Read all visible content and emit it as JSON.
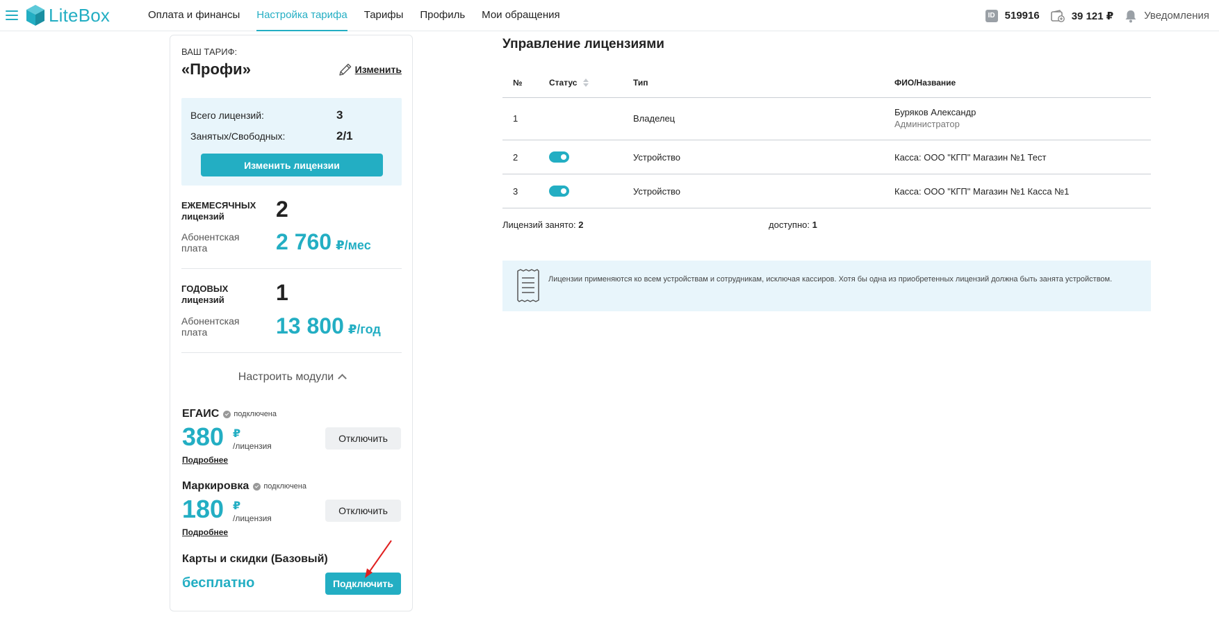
{
  "header": {
    "logo_text": "LiteBox",
    "nav": [
      {
        "label": "Оплата и финансы",
        "active": false
      },
      {
        "label": "Настройка тарифа",
        "active": true
      },
      {
        "label": "Тарифы",
        "active": false
      },
      {
        "label": "Профиль",
        "active": false
      },
      {
        "label": "Мои обращения",
        "active": false
      }
    ],
    "id_badge": "ID",
    "account_id": "519916",
    "balance": "39 121 ₽",
    "notifications_label": "Уведомления"
  },
  "tariff": {
    "label": "ВАШ ТАРИФ:",
    "name": "«Профи»",
    "edit_label": "Изменить",
    "licenses": {
      "total_label": "Всего лицензий:",
      "total_value": "3",
      "used_free_label": "Занятых/Свободных:",
      "used_free_value": "2/1",
      "change_button": "Изменить лицензии"
    },
    "monthly": {
      "title_line1": "ЕЖЕМЕСЯЧНЫХ",
      "title_line2": "лицензий",
      "count": "2",
      "fee_label_line1": "Абонентская",
      "fee_label_line2": "плата",
      "fee_value": "2 760",
      "fee_unit": "₽/мес"
    },
    "yearly": {
      "title_line1": "ГОДОВЫХ",
      "title_line2": "лицензий",
      "count": "1",
      "fee_label_line1": "Абонентская",
      "fee_label_line2": "плата",
      "fee_value": "13 800",
      "fee_unit": "₽/год"
    },
    "modules_toggle": "Настроить модули",
    "modules": [
      {
        "name": "ЕГАИС",
        "status": "подключена",
        "price": "380",
        "currency": "₽",
        "per": "/лицензия",
        "more": "Подробнее",
        "button": "Отключить"
      },
      {
        "name": "Маркировка",
        "status": "подключена",
        "price": "180",
        "currency": "₽",
        "per": "/лицензия",
        "more": "Подробнее",
        "button": "Отключить"
      },
      {
        "name": "Карты и скидки (Базовый)",
        "price_text": "бесплатно",
        "button": "Подключить"
      }
    ]
  },
  "licenses_management": {
    "title": "Управление лицензиями",
    "columns": [
      "№",
      "Статус",
      "Тип",
      "ФИО/Название"
    ],
    "rows": [
      {
        "num": "1",
        "status_on": false,
        "type": "Владелец",
        "name": "Буряков Александр",
        "sub": "Администратор"
      },
      {
        "num": "2",
        "status_on": true,
        "type": "Устройство",
        "name": "Касса: ООО \"КГП\" Магазин №1 Тест",
        "sub": ""
      },
      {
        "num": "3",
        "status_on": true,
        "type": "Устройство",
        "name": "Касса: ООО \"КГП\" Магазин №1 Касса №1",
        "sub": ""
      }
    ],
    "summary_used_label": "Лицензий занято:",
    "summary_used_value": "2",
    "summary_available_label": "доступно:",
    "summary_available_value": "1",
    "info_text": "Лицензии применяются ко всем устройствам и сотрудникам, исключая кассиров. Хотя бы одна из приобретенных лицензий должна быть занята устройством."
  },
  "colors": {
    "accent": "#23aec3",
    "info_bg": "#e8f5fb",
    "annotation_arrow": "#e02020"
  }
}
